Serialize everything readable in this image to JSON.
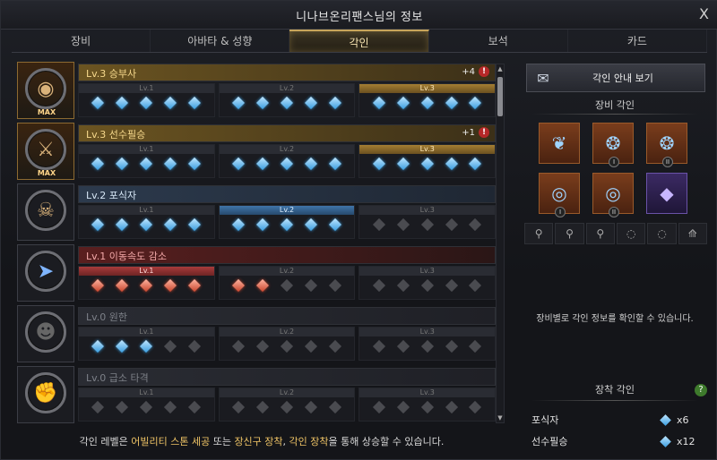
{
  "window": {
    "title": "니나브온리팬스님의 정보",
    "close": "X"
  },
  "tabs": [
    "장비",
    "아바타 & 성향",
    "각인",
    "보석",
    "카드"
  ],
  "engravings": [
    {
      "title": "Lv.3 승부사",
      "state": "gold",
      "extra": "+4",
      "warn": "!",
      "max": "MAX",
      "icon": "eye-icon",
      "levels": [
        {
          "label": "Lv.1",
          "style": "plain",
          "gems": [
            "blue",
            "blue",
            "blue",
            "blue",
            "blue"
          ]
        },
        {
          "label": "Lv.2",
          "style": "plain",
          "gems": [
            "blue",
            "blue",
            "blue",
            "blue",
            "blue"
          ]
        },
        {
          "label": "Lv.3",
          "style": "gold",
          "gems": [
            "blue",
            "blue",
            "blue",
            "blue",
            "blue"
          ]
        }
      ]
    },
    {
      "title": "Lv.3 선수필승",
      "state": "gold",
      "extra": "+1",
      "warn": "!",
      "max": "MAX",
      "icon": "blade-icon",
      "levels": [
        {
          "label": "Lv.1",
          "style": "plain",
          "gems": [
            "blue",
            "blue",
            "blue",
            "blue",
            "blue"
          ]
        },
        {
          "label": "Lv.2",
          "style": "plain",
          "gems": [
            "blue",
            "blue",
            "blue",
            "blue",
            "blue"
          ]
        },
        {
          "label": "Lv.3",
          "style": "gold",
          "gems": [
            "blue",
            "blue",
            "blue",
            "blue",
            "blue"
          ]
        }
      ]
    },
    {
      "title": "Lv.2 포식자",
      "state": "blue",
      "extra": "",
      "warn": "",
      "max": "",
      "icon": "beast-icon",
      "levels": [
        {
          "label": "Lv.1",
          "style": "plain",
          "gems": [
            "blue",
            "blue",
            "blue",
            "blue",
            "blue"
          ]
        },
        {
          "label": "Lv.2",
          "style": "blue",
          "gems": [
            "blue",
            "blue",
            "blue",
            "blue",
            "blue"
          ]
        },
        {
          "label": "Lv.3",
          "style": "plain",
          "gems": [
            "grey",
            "grey",
            "grey",
            "grey",
            "grey"
          ]
        }
      ]
    },
    {
      "title": "Lv.1 이동속도 감소",
      "state": "red",
      "extra": "",
      "warn": "",
      "max": "",
      "icon": "boot-icon",
      "levels": [
        {
          "label": "Lv.1",
          "style": "red",
          "gems": [
            "red",
            "red",
            "red",
            "red",
            "red"
          ]
        },
        {
          "label": "Lv.2",
          "style": "plain",
          "gems": [
            "red",
            "red",
            "grey",
            "grey",
            "grey"
          ]
        },
        {
          "label": "Lv.3",
          "style": "plain",
          "gems": [
            "grey",
            "grey",
            "grey",
            "grey",
            "grey"
          ]
        }
      ]
    },
    {
      "title": "Lv.0 원한",
      "state": "dim",
      "extra": "",
      "warn": "",
      "max": "",
      "icon": "skull-icon",
      "levels": [
        {
          "label": "Lv.1",
          "style": "plain",
          "gems": [
            "blue",
            "blue",
            "blue",
            "grey",
            "grey"
          ]
        },
        {
          "label": "Lv.2",
          "style": "plain",
          "gems": [
            "grey",
            "grey",
            "grey",
            "grey",
            "grey"
          ]
        },
        {
          "label": "Lv.3",
          "style": "plain",
          "gems": [
            "grey",
            "grey",
            "grey",
            "grey",
            "grey"
          ]
        }
      ]
    },
    {
      "title": "Lv.0 급소 타격",
      "state": "dim",
      "extra": "",
      "warn": "",
      "max": "",
      "icon": "fist-icon",
      "levels": [
        {
          "label": "Lv.1",
          "style": "plain",
          "gems": [
            "grey",
            "grey",
            "grey",
            "grey",
            "grey"
          ]
        },
        {
          "label": "Lv.2",
          "style": "plain",
          "gems": [
            "grey",
            "grey",
            "grey",
            "grey",
            "grey"
          ]
        },
        {
          "label": "Lv.3",
          "style": "plain",
          "gems": [
            "grey",
            "grey",
            "grey",
            "grey",
            "grey"
          ]
        }
      ]
    }
  ],
  "footer": {
    "part1": "각인 레벨은 ",
    "hl1": "어빌리티 스톤 세공",
    "part2": " 또는 ",
    "hl2": "장신구 장착",
    "part3": ", ",
    "hl3": "각인 장착",
    "part4": "을 통해 상승할 수 있습니다."
  },
  "right": {
    "guide_button": "각인 안내 보기",
    "equip_heading": "장비 각인",
    "equipment": [
      {
        "icon": "necklace-icon",
        "tier": "",
        "style": "orange"
      },
      {
        "icon": "earring-icon",
        "tier": "I",
        "style": "orange"
      },
      {
        "icon": "earring-icon",
        "tier": "II",
        "style": "orange"
      },
      {
        "icon": "ring-icon",
        "tier": "I",
        "style": "orange"
      },
      {
        "icon": "ring-icon",
        "tier": "II",
        "style": "orange"
      },
      {
        "icon": "ability-stone-icon",
        "tier": "",
        "style": "purple"
      }
    ],
    "slots": [
      "necklace-slot",
      "earring-1-slot",
      "earring-2-slot",
      "ring-1-slot",
      "ring-2-slot",
      "stone-slot"
    ],
    "hint": "장비별로 각인 정보를 확인할 수 있습니다.",
    "equipped_heading": "장착 각인",
    "help": "?",
    "equipped": [
      {
        "name": "포식자",
        "count": "x6"
      },
      {
        "name": "선수필승",
        "count": "x12"
      }
    ]
  },
  "colors": {
    "gold": "#c8a55a",
    "blue_gem": "#3a9ee0",
    "red_gem": "#c8452c"
  }
}
